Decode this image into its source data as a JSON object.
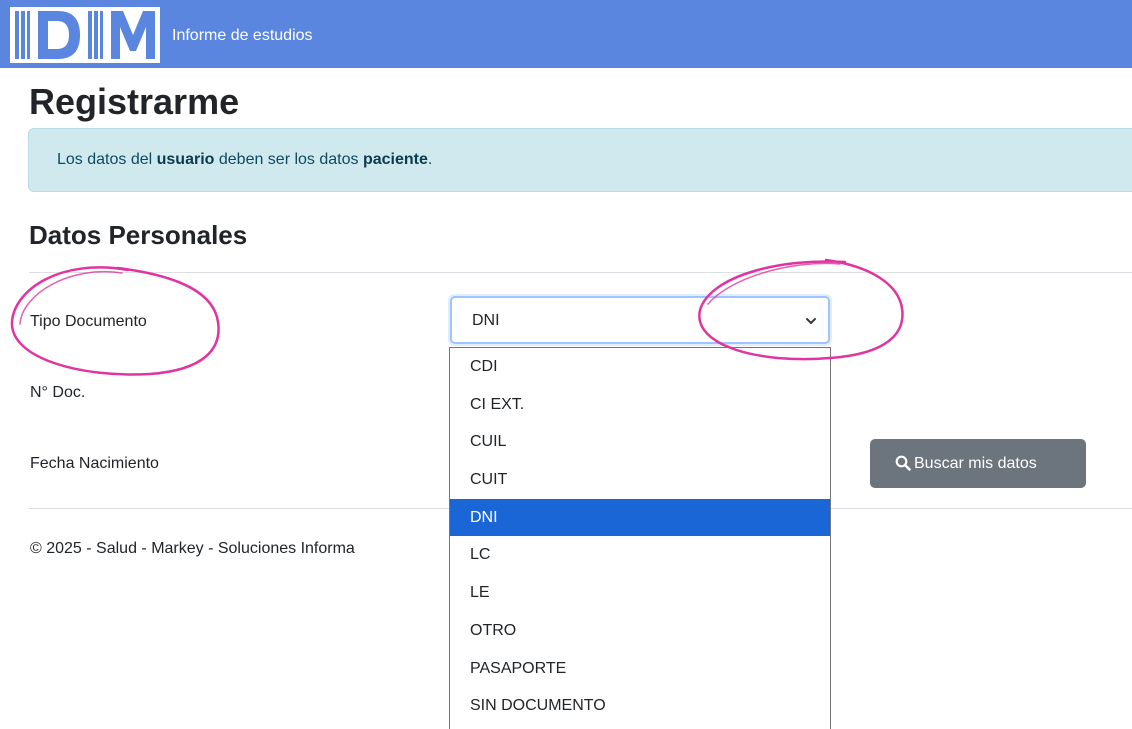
{
  "navbar": {
    "logo_text": "IDIM",
    "subtitle": "Informe de estudios",
    "color": "#5b86e0"
  },
  "page": {
    "title": "Registrarme"
  },
  "alert": {
    "prefix": "Los datos del ",
    "bold1": "usuario",
    "middle": " deben ser los datos ",
    "bold2": "paciente",
    "suffix": "."
  },
  "section": {
    "title": "Datos Personales"
  },
  "form": {
    "tipo_documento_label": "Tipo Documento",
    "num_doc_label": "N° Doc.",
    "fecha_nacimiento_label": "Fecha Nacimiento",
    "tipo_documento_value": "DNI",
    "options": [
      "CDI",
      "CI EXT.",
      "CUIL",
      "CUIT",
      "DNI",
      "LC",
      "LE",
      "OTRO",
      "PASAPORTE",
      "SIN DOCUMENTO"
    ],
    "selected_option": "DNI",
    "search_button_label": "Buscar mis datos",
    "search_icon": "search-icon"
  },
  "footer": {
    "text": "© 2025 - Salud - Markey - Soluciones Informa"
  },
  "colors": {
    "accent": "#1a66d6",
    "annotation": "#e0359f",
    "button": "#6c757d"
  }
}
